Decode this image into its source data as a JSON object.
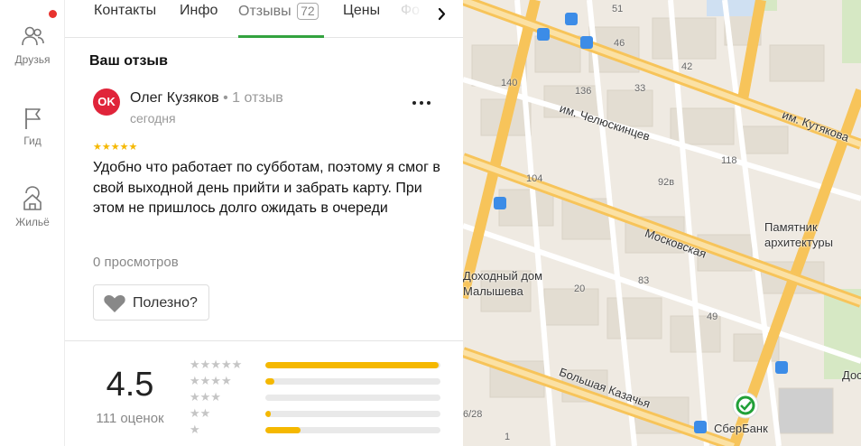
{
  "rail": {
    "items": [
      {
        "label": "Друзья",
        "icon": "friends-icon"
      },
      {
        "label": "Гид",
        "icon": "flag-icon"
      },
      {
        "label": "Жильё",
        "icon": "housing-icon"
      }
    ],
    "notification_dot_color": "#e8322e"
  },
  "tabs": {
    "items": [
      {
        "label": "Контакты"
      },
      {
        "label": "Инфо"
      },
      {
        "label": "Отзывы",
        "count": "72",
        "active": true
      },
      {
        "label": "Цены"
      },
      {
        "label": "Фо"
      }
    ],
    "accent_color": "#33a33f"
  },
  "review": {
    "section_title": "Ваш отзыв",
    "avatar_text": "OK",
    "author": "Олег Кузяков",
    "author_meta": " • 1 отзыв",
    "date": "сегодня",
    "rating": 5,
    "text": "Удобно что работает по субботам, поэтому я смог в свой выходной день прийти и забрать карту. При этом не пришлось долго ожидать в очереди",
    "views": "0 просмотров",
    "helpful_label": "Полезно?"
  },
  "summary": {
    "rating": "4.5",
    "count_label": "111 оценок",
    "distribution": [
      {
        "stars": 5,
        "fraction": 0.99
      },
      {
        "stars": 4,
        "fraction": 0.05
      },
      {
        "stars": 3,
        "fraction": 0.0
      },
      {
        "stars": 2,
        "fraction": 0.03
      },
      {
        "stars": 1,
        "fraction": 0.2
      }
    ],
    "bar_color": "#f5b800"
  },
  "map": {
    "streets": [
      "им. Челюскинцев",
      "им. Кутякова",
      "Московская",
      "Большая Казачья"
    ],
    "places": [
      "Памятник",
      "архитектуры",
      "Доходный дом",
      "Малышева",
      "СберБанк",
      "Дос"
    ],
    "house_numbers": [
      "51",
      "46",
      "42",
      "140",
      "136",
      "33",
      "118",
      "104",
      "92в",
      "83",
      "20",
      "49",
      "6/28",
      "1"
    ]
  }
}
